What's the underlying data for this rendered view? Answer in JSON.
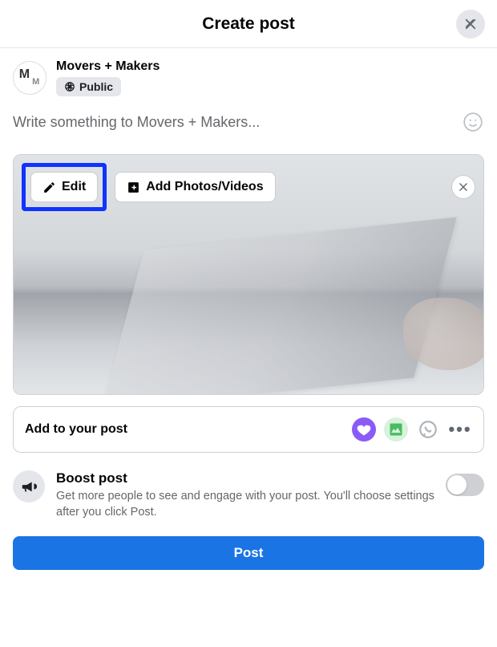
{
  "header": {
    "title": "Create post"
  },
  "author": {
    "name": "Movers + Makers",
    "privacy": "Public",
    "avatar_initials": "M"
  },
  "compose": {
    "placeholder": "Write something to Movers + Makers..."
  },
  "media": {
    "edit_label": "Edit",
    "add_label": "Add Photos/Videos",
    "highlighted_button": "edit"
  },
  "add_to_post": {
    "label": "Add to your post"
  },
  "boost": {
    "title": "Boost post",
    "desc": "Get more people to see and engage with your post. You'll choose settings after you click Post.",
    "enabled": false
  },
  "actions": {
    "post_label": "Post"
  },
  "colors": {
    "accent": "#1b74e4",
    "highlight": "#1033ff"
  }
}
